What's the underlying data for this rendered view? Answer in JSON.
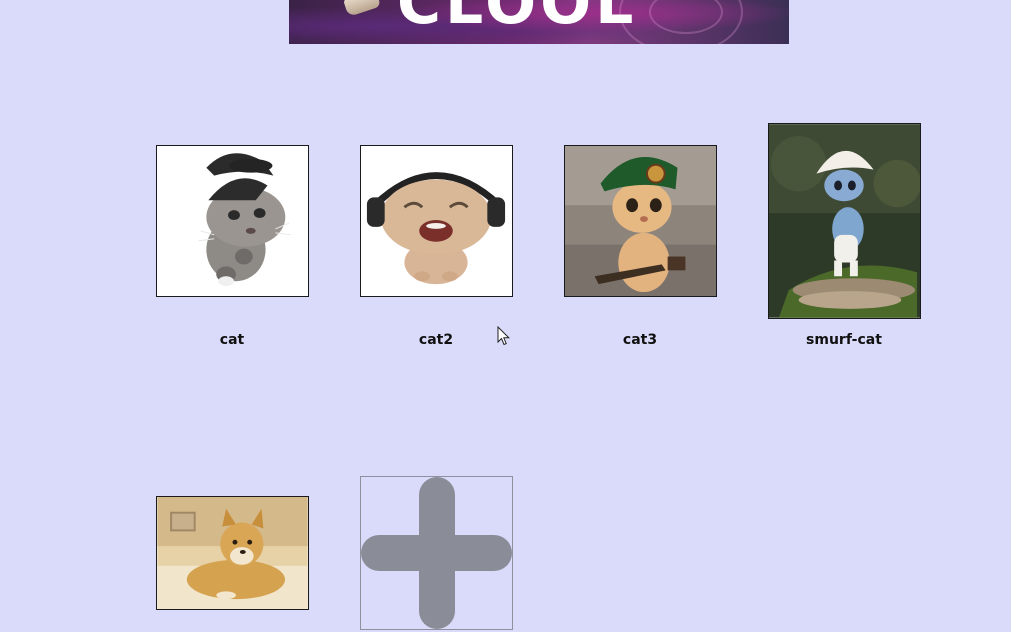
{
  "header": {
    "banner_title": "CLOOL"
  },
  "gallery": {
    "items": [
      {
        "label": "cat"
      },
      {
        "label": "cat2"
      },
      {
        "label": "cat3"
      },
      {
        "label": "smurf-cat"
      },
      {
        "label": ""
      }
    ],
    "add_icon": "plus-icon"
  },
  "colors": {
    "background": "#dadbfa",
    "add_button": "#8a8c98"
  }
}
